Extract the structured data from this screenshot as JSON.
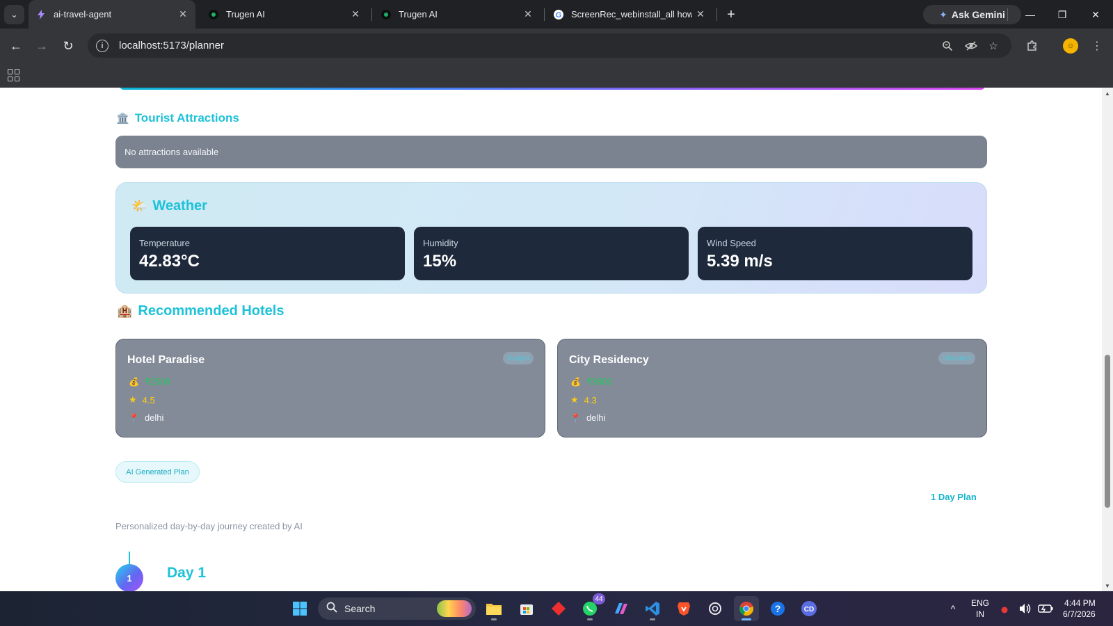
{
  "browser": {
    "tabs": [
      {
        "title": "ai-travel-agent",
        "favicon": "bolt-icon",
        "active": true
      },
      {
        "title": "Trugen AI",
        "favicon": "trugen-icon",
        "active": false
      },
      {
        "title": "Trugen AI",
        "favicon": "trugen-icon",
        "active": false
      },
      {
        "title": "ScreenRec_webinstall_all how to",
        "favicon": "google-icon",
        "active": false
      }
    ],
    "ask_gemini_label": "Ask Gemini",
    "url": "localhost:5173/planner"
  },
  "page": {
    "attractions": {
      "emoji": "🏛️",
      "title": "Tourist Attractions",
      "empty_text": "No attractions available"
    },
    "weather": {
      "emoji": "🌤️",
      "title": "Weather",
      "cards": [
        {
          "label": "Temperature",
          "value": "42.83°C"
        },
        {
          "label": "Humidity",
          "value": "15%"
        },
        {
          "label": "Wind Speed",
          "value": "5.39 m/s"
        }
      ]
    },
    "hotels": {
      "emoji": "🏨",
      "title": "Recommended Hotels",
      "items": [
        {
          "name": "Hotel Paradise",
          "badge": "Budget",
          "price": "₹2500",
          "rating": "4.5",
          "location": "delhi"
        },
        {
          "name": "City Residency",
          "badge": "Standard",
          "price": "₹3800",
          "rating": "4.3",
          "location": "delhi"
        }
      ]
    },
    "plan": {
      "pill_label": "AI Generated Plan",
      "day_plan_label": "1 Day Plan",
      "subtitle": "Personalized day-by-day journey created by AI",
      "day_number": "1",
      "day_title": "Day 1"
    }
  },
  "taskbar": {
    "search_label": "Search",
    "whatsapp_badge": "44",
    "lang_top": "ENG",
    "lang_bottom": "IN",
    "time": "4:44 PM",
    "date": "6/7/2026"
  },
  "colors": {
    "accent": "#1ec2d8",
    "card_dark": "#1e293b",
    "hotel_card": "#848b98",
    "price_green": "#22c55e",
    "rating_yellow": "#facc15"
  }
}
